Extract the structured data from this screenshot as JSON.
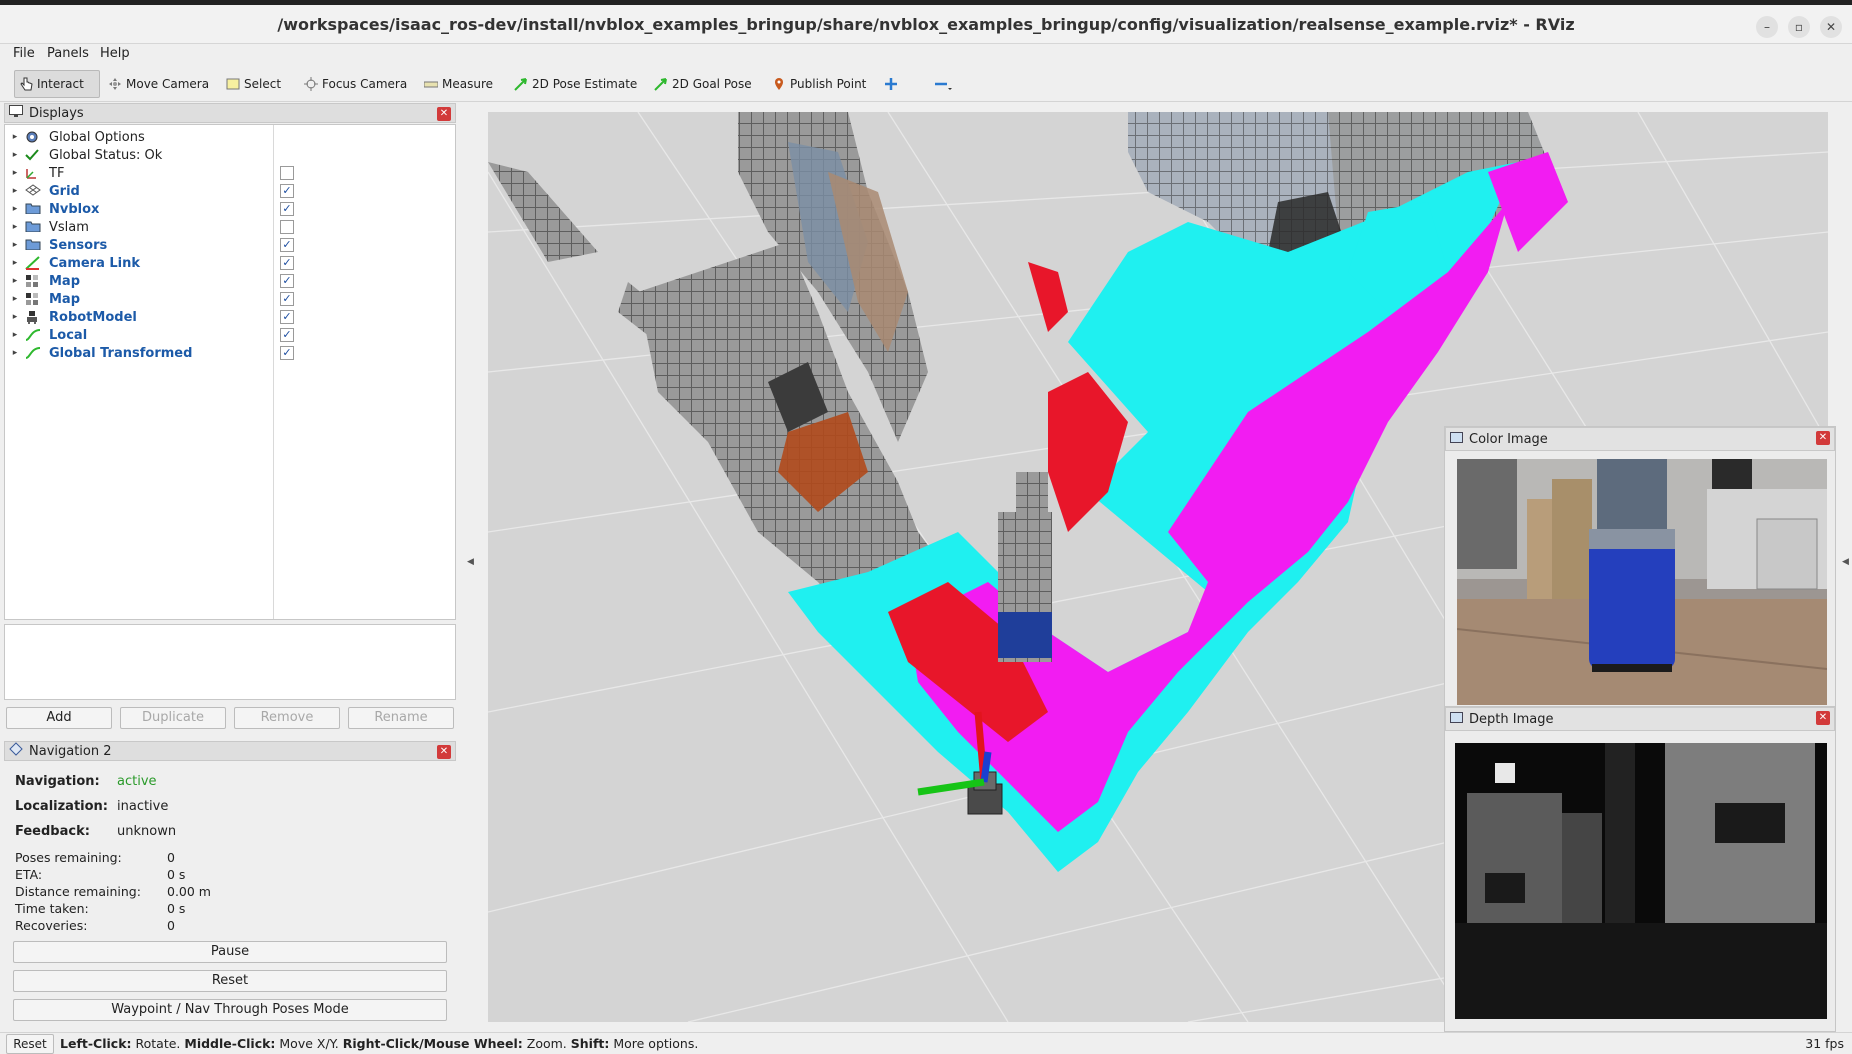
{
  "window": {
    "title": "/workspaces/isaac_ros-dev/install/nvblox_examples_bringup/share/nvblox_examples_bringup/config/visualization/realsense_example.rviz* - RViz",
    "minimize": "–",
    "maximize": "▫",
    "close": "✕"
  },
  "menu": {
    "file": "File",
    "panels": "Panels",
    "help": "Help"
  },
  "toolbar": {
    "interact": "Interact",
    "move_camera": "Move Camera",
    "select": "Select",
    "focus_camera": "Focus Camera",
    "measure": "Measure",
    "pose_estimate": "2D Pose Estimate",
    "goal_pose": "2D Goal Pose",
    "publish_point": "Publish Point"
  },
  "displays": {
    "title": "Displays",
    "items": [
      {
        "label": "Global Options",
        "checked": null
      },
      {
        "label": "Global Status: Ok",
        "checked": null
      },
      {
        "label": "TF",
        "checked": false
      },
      {
        "label": "Grid",
        "checked": true
      },
      {
        "label": "Nvblox",
        "checked": true
      },
      {
        "label": "Vslam",
        "checked": false
      },
      {
        "label": "Sensors",
        "checked": true
      },
      {
        "label": "Camera Link",
        "checked": true
      },
      {
        "label": "Map",
        "checked": true
      },
      {
        "label": "Map",
        "checked": true
      },
      {
        "label": "RobotModel",
        "checked": true
      },
      {
        "label": "Local",
        "checked": true
      },
      {
        "label": "Global Transformed",
        "checked": true
      }
    ],
    "check_mark": "✓",
    "buttons": {
      "add": "Add",
      "duplicate": "Duplicate",
      "remove": "Remove",
      "rename": "Rename"
    }
  },
  "navigation": {
    "title": "Navigation 2",
    "navigation_label": "Navigation:",
    "navigation_value": "active",
    "localization_label": "Localization:",
    "localization_value": "inactive",
    "feedback_label": "Feedback:",
    "feedback_value": "unknown",
    "poses_label": "Poses remaining:",
    "poses_value": "0",
    "eta_label": "ETA:",
    "eta_value": "0 s",
    "distance_label": "Distance remaining:",
    "distance_value": "0.00 m",
    "time_label": "Time taken:",
    "time_value": "0 s",
    "recoveries_label": "Recoveries:",
    "recoveries_value": "0",
    "pause": "Pause",
    "reset": "Reset",
    "waypoint": "Waypoint / Nav Through Poses Mode"
  },
  "color_image": {
    "title": "Color Image"
  },
  "depth_image": {
    "title": "Depth Image"
  },
  "statusbar": {
    "reset": "Reset",
    "left_click_key": "Left-Click:",
    "left_click_val": " Rotate. ",
    "middle_click_key": "Middle-Click:",
    "middle_click_val": " Move X/Y. ",
    "right_click_key": "Right-Click/Mouse Wheel:",
    "right_click_val": " Zoom. ",
    "shift_key": "Shift:",
    "shift_val": " More options.",
    "fps": "31 fps"
  },
  "colors": {
    "cyan": "#1ff0f0",
    "magenta": "#f21cf2",
    "red": "#e8162a",
    "voxel_gray": "#8a8a8a",
    "active_green": "#2a9a2a"
  }
}
